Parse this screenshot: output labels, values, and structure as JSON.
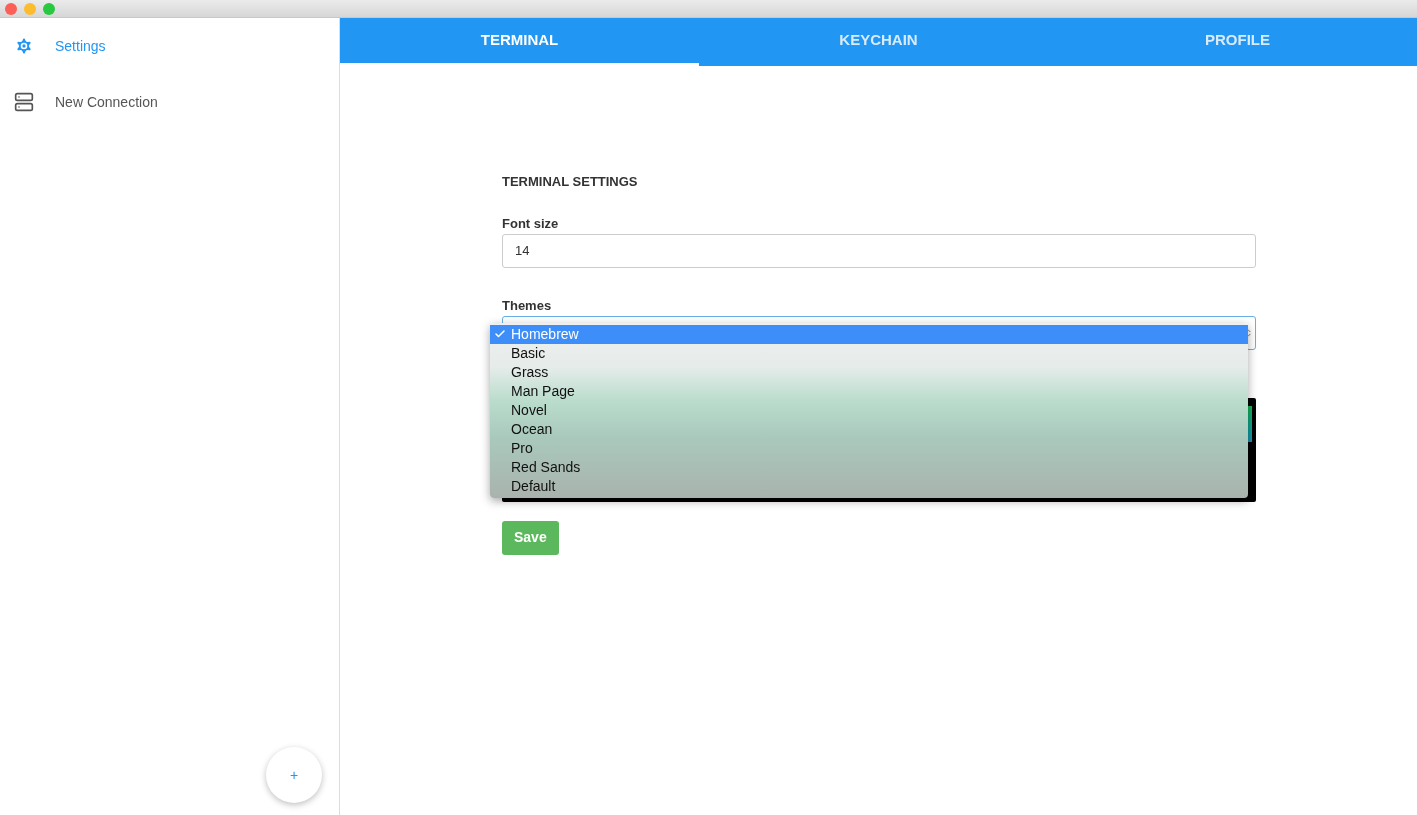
{
  "sidebar": {
    "items": [
      {
        "kind": "settings",
        "label": "Settings",
        "selected": true
      },
      {
        "kind": "server",
        "label": "New Connection",
        "selected": false
      }
    ],
    "add_button": "+"
  },
  "tabs": [
    {
      "label": "TERMINAL",
      "selected": true
    },
    {
      "label": "KEYCHAIN",
      "selected": false
    },
    {
      "label": "PROFILE",
      "selected": false
    }
  ],
  "form": {
    "heading": "TERMINAL SETTINGS",
    "font_size": {
      "label": "Font size",
      "value": "14"
    },
    "themes": {
      "label": "Themes",
      "options": [
        {
          "label": "Homebrew",
          "selected": true
        },
        {
          "label": "Basic",
          "selected": false
        },
        {
          "label": "Grass",
          "selected": false
        },
        {
          "label": "Man Page",
          "selected": false
        },
        {
          "label": "Novel",
          "selected": false
        },
        {
          "label": "Ocean",
          "selected": false
        },
        {
          "label": "Pro",
          "selected": false
        },
        {
          "label": "Red Sands",
          "selected": false
        },
        {
          "label": "Default",
          "selected": false
        }
      ]
    },
    "save": "Save"
  }
}
